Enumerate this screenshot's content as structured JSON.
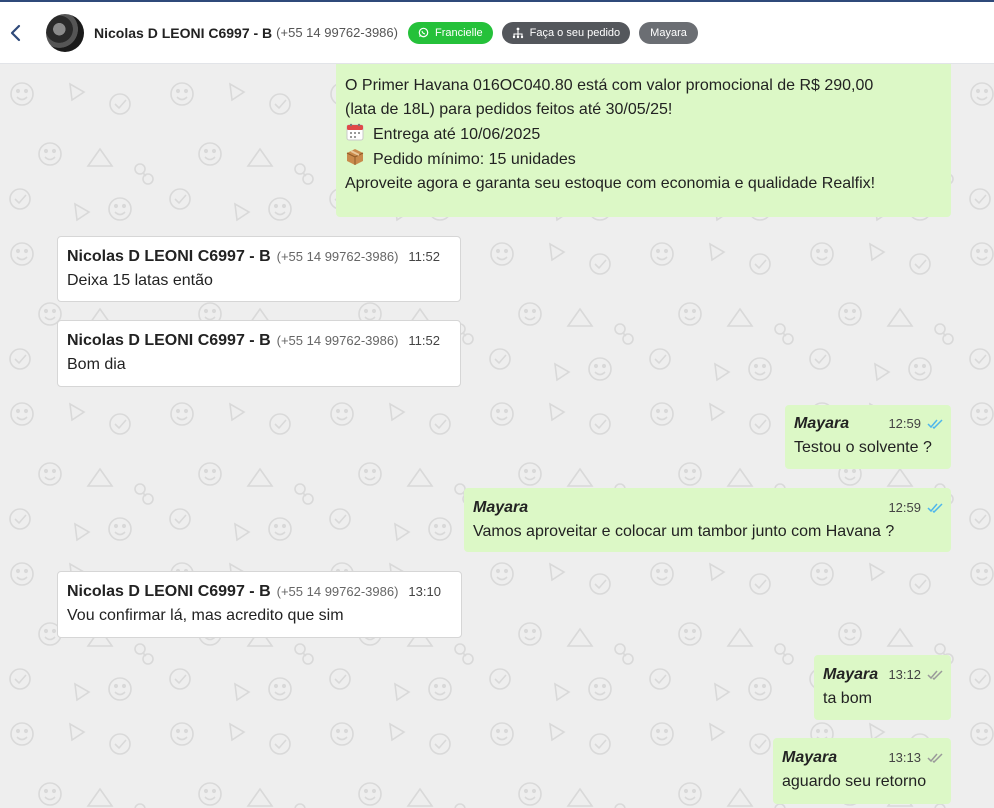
{
  "header": {
    "contact_name": "Nicolas D LEONI C6997 - B",
    "contact_phone": "(+55 14 99762-3986)",
    "tag_whatsapp": "Francielle",
    "tag_order": "Faça o seu pedido",
    "tag_agent": "Mayara"
  },
  "promo": {
    "line1": "O Primer Havana 016OC040.80 está com valor promocional de R$ 290,00",
    "line2": "(lata de 18L) para pedidos feitos até 30/05/25!",
    "line3": "Entrega até 10/06/2025",
    "line4": "Pedido mínimo: 15 unidades",
    "line5": "Aproveite agora e garanta seu estoque com economia e qualidade Realfix!"
  },
  "messages": [
    {
      "sender": "Nicolas D LEONI C6997 - B",
      "phone": "(+55 14 99762-3986)",
      "time": "11:52",
      "text": "Deixa 15 latas então"
    },
    {
      "sender": "Nicolas D LEONI C6997 - B",
      "phone": "(+55 14 99762-3986)",
      "time": "11:52",
      "text": "Bom dia"
    },
    {
      "sender": "Mayara",
      "time": "12:59",
      "text": "Testou o solvente ?",
      "status": "read"
    },
    {
      "sender": "Mayara",
      "time": "12:59",
      "text": "Vamos aproveitar e colocar um tambor junto com Havana ?",
      "status": "read"
    },
    {
      "sender": "Nicolas D LEONI C6997 - B",
      "phone": "(+55 14 99762-3986)",
      "time": "13:10",
      "text": "Vou confirmar lá, mas acredito que sim"
    },
    {
      "sender": "Mayara",
      "time": "13:12",
      "text": "ta bom",
      "status": "delivered"
    },
    {
      "sender": "Mayara",
      "time": "13:13",
      "text": "aguardo seu retorno",
      "status": "delivered"
    }
  ],
  "icons": {
    "back": "chevron-left-icon",
    "whatsapp": "whatsapp-icon",
    "order": "network-icon",
    "calendar": "calendar-icon",
    "package": "package-icon",
    "read": "double-check-blue-icon",
    "delivered": "double-check-gray-icon"
  },
  "colors": {
    "chat_bg": "#eeeeee",
    "outgoing_bubble": "#dcf8c6",
    "incoming_bubble": "#ffffff",
    "tag_green": "#25c13a",
    "read_check": "#4fb6ec"
  }
}
